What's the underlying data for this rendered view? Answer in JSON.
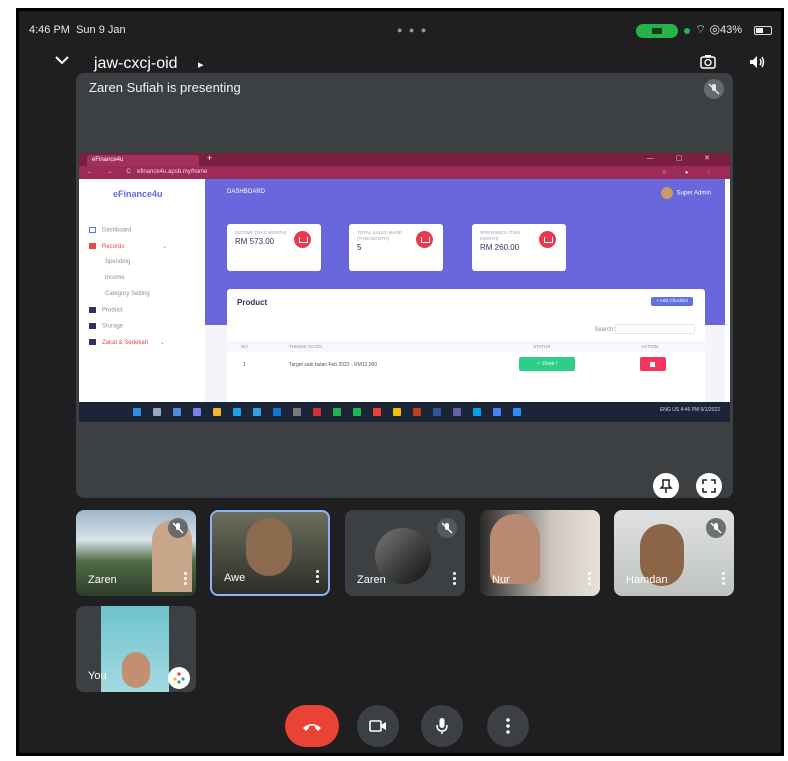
{
  "status_bar": {
    "time": "4:46 PM",
    "date": "Sun 9 Jan",
    "battery": "43%"
  },
  "meeting": {
    "code": "jaw-cxcj-oid",
    "code_caret": "▸"
  },
  "presentation": {
    "banner": "Zaren Sufiah is presenting",
    "shared_screen": {
      "tab_title": "eFinance4u",
      "url": "efinance4u.apsb.my/home",
      "brand": "eFinance4u",
      "page_title": "DASHBOARD",
      "user": "Super Admin",
      "sidebar": [
        {
          "label": "Dashboard"
        },
        {
          "label": "Records"
        },
        {
          "label": "Spending"
        },
        {
          "label": "Income"
        },
        {
          "label": "Category Setting"
        },
        {
          "label": "Product"
        },
        {
          "label": "Storage"
        },
        {
          "label": "Zakat & Sedekah"
        }
      ],
      "stats": [
        {
          "label": "INCOME (THIS MONTH)",
          "value": "RM 573.00"
        },
        {
          "label": "TOTAL SALES MADE (THIS MONTH)",
          "value": "5"
        },
        {
          "label": "SPENDINGS (THIS MONTH)",
          "value": "RM 260.00"
        }
      ],
      "card_title": "Product",
      "add_button": "+ Add Checklist",
      "search_label": "Search:",
      "table_headers": [
        "NO",
        "THINGS TO DO",
        "STATUS",
        "ACTION"
      ],
      "table_rows": [
        {
          "no": "1",
          "task": "Target sale bulan Feb 2022 - RM12,000",
          "status": "✓ Done !"
        }
      ],
      "taskbar_tray": "ENG US  4:46 PM 9/1/2022"
    }
  },
  "participants": [
    {
      "name": "Zaren",
      "muted": true
    },
    {
      "name": "Awe",
      "muted": false
    },
    {
      "name": "Zaren",
      "muted": true
    },
    {
      "name": "Nur",
      "muted": false
    },
    {
      "name": "Hamdan",
      "muted": true
    }
  ],
  "self_tile": {
    "name": "You"
  },
  "colors": {
    "end_call": "#ea4335",
    "active_speaker": "#8ab4f8",
    "app_hero": "#6a66dc"
  }
}
